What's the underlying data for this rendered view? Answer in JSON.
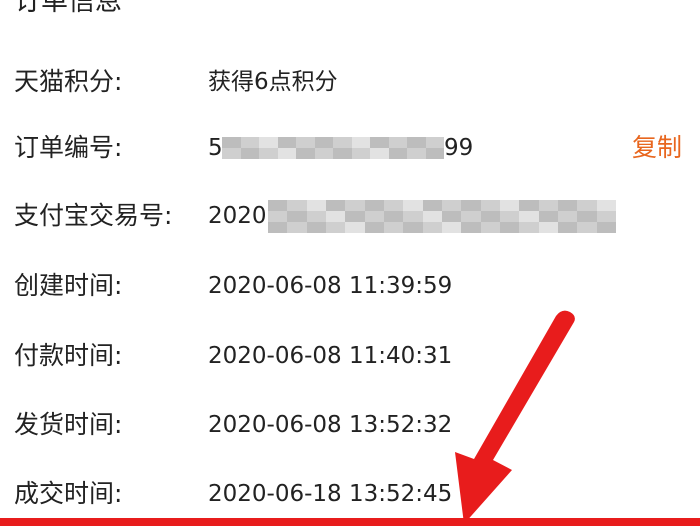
{
  "section": {
    "title": "订单信息"
  },
  "rows": [
    {
      "label": "天猫积分:",
      "value": "获得6点积分"
    },
    {
      "label": "订单编号:",
      "value_prefix": "5",
      "value_suffix": "99",
      "action": "复制"
    },
    {
      "label": "支付宝交易号:",
      "value_prefix": "2020"
    },
    {
      "label": "创建时间:",
      "value": "2020-06-08 11:39:59"
    },
    {
      "label": "付款时间:",
      "value": "2020-06-08 11:40:31"
    },
    {
      "label": "发货时间:",
      "value": "2020-06-08 13:52:32"
    },
    {
      "label": "成交时间:",
      "value": "2020-06-18 13:52:45"
    }
  ],
  "colors": {
    "accent": "#e8661e",
    "annotation_red": "#e81c1c",
    "mosaic_dark": "#bdbdbd",
    "mosaic_light": "#e2e2e2"
  },
  "annotation": {
    "icon": "red-arrow-icon"
  }
}
